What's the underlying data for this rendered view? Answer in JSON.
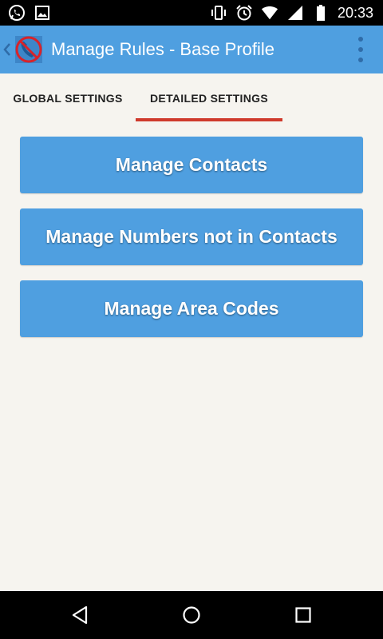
{
  "status_bar": {
    "left_icons": [
      "whatsapp-icon",
      "image-icon"
    ],
    "right_icons": [
      "vibrate-icon",
      "alarm-icon",
      "wifi-icon",
      "signal-icon",
      "battery-icon"
    ],
    "time": "20:33"
  },
  "action_bar": {
    "title": "Manage Rules - Base Profile",
    "back_icon": "chevron-left-icon",
    "logo_icon": "blocked-phone-icon",
    "menu_icon": "overflow-menu-icon",
    "color": "#4f9fe0"
  },
  "tabs": [
    {
      "label": "GLOBAL SETTINGS",
      "selected": false
    },
    {
      "label": "DETAILED SETTINGS",
      "selected": true
    }
  ],
  "tab_indicator_color": "#cf3a2c",
  "buttons": [
    {
      "label": "Manage Contacts"
    },
    {
      "label": "Manage Numbers not in Contacts"
    },
    {
      "label": "Manage Area Codes"
    }
  ],
  "nav_bar": {
    "icons": [
      "back-triangle-icon",
      "home-circle-icon",
      "recents-square-icon"
    ]
  }
}
